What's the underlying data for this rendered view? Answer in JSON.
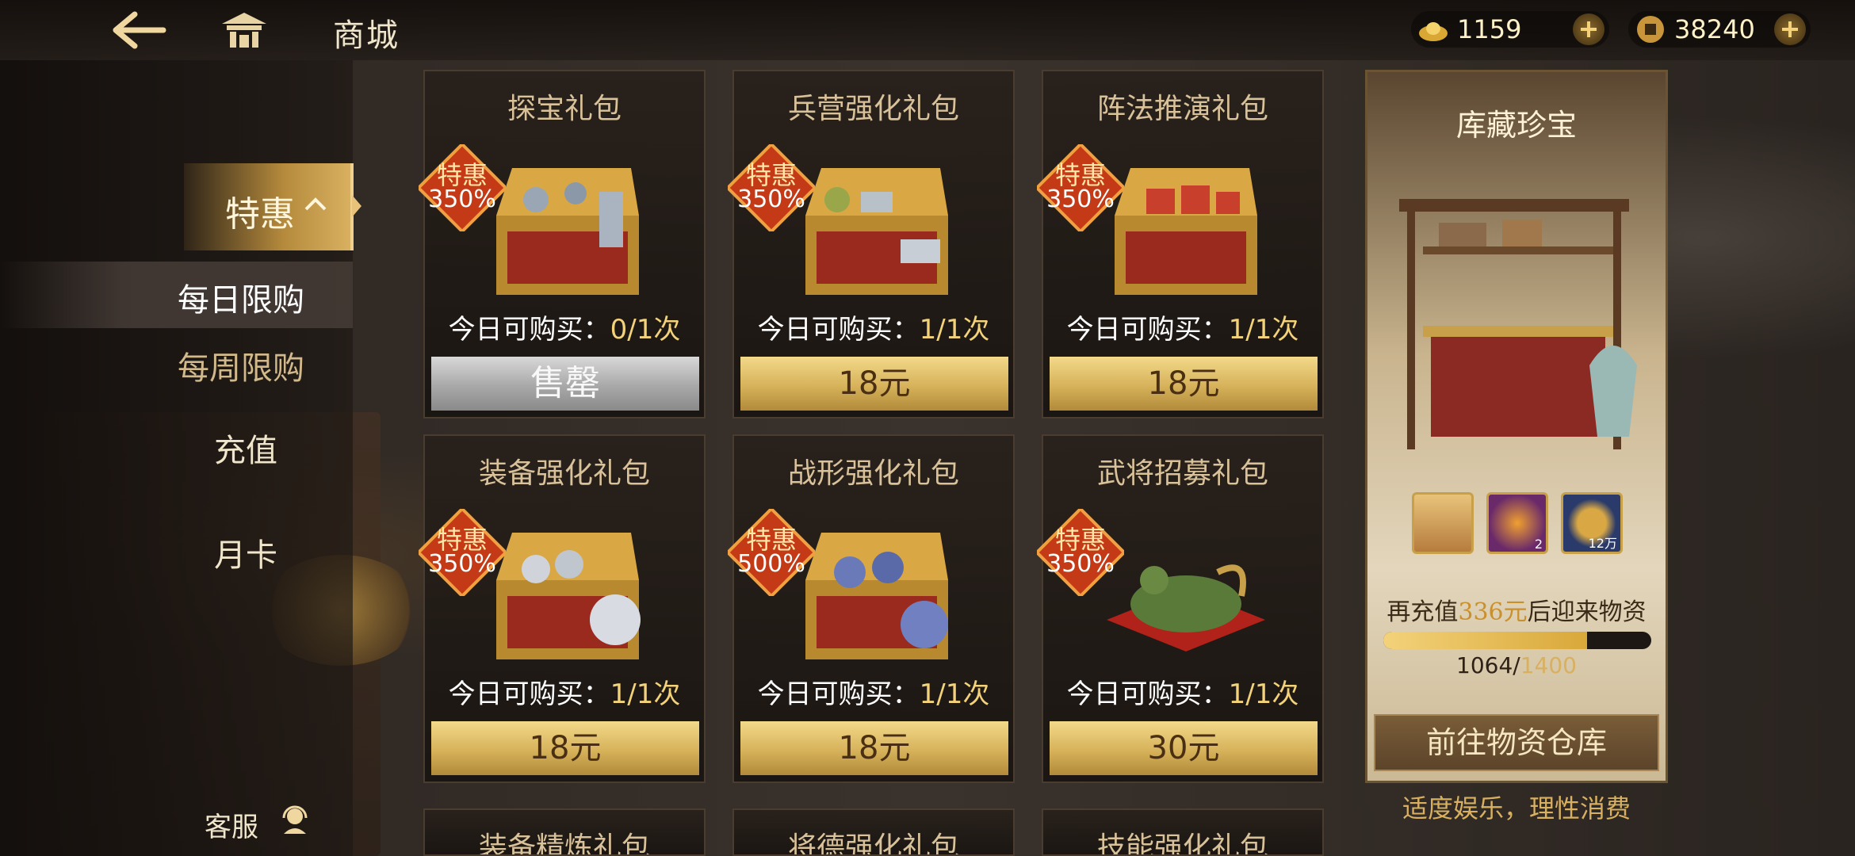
{
  "header": {
    "title": "商城"
  },
  "currency": {
    "gold": "1159",
    "coin": "38240"
  },
  "nav": {
    "main_tab": "特惠",
    "sub_tabs": [
      {
        "label": "每日限购"
      },
      {
        "label": "每周限购"
      }
    ],
    "items": [
      {
        "label": "充值"
      },
      {
        "label": "月卡"
      }
    ],
    "service": "客服"
  },
  "products": [
    {
      "name": "探宝礼包",
      "badge": "特惠",
      "percent": "350%",
      "limit_prefix": "今日可购买：",
      "limit": "0/1次",
      "price": "售罄"
    },
    {
      "name": "兵营强化礼包",
      "badge": "特惠",
      "percent": "350%",
      "limit_prefix": "今日可购买：",
      "limit": "1/1次",
      "price": "18元"
    },
    {
      "name": "阵法推演礼包",
      "badge": "特惠",
      "percent": "350%",
      "limit_prefix": "今日可购买：",
      "limit": "1/1次",
      "price": "18元"
    },
    {
      "name": "装备强化礼包",
      "badge": "特惠",
      "percent": "350%",
      "limit_prefix": "今日可购买：",
      "limit": "1/1次",
      "price": "18元"
    },
    {
      "name": "战形强化礼包",
      "badge": "特惠",
      "percent": "500%",
      "limit_prefix": "今日可购买：",
      "limit": "1/1次",
      "price": "18元"
    },
    {
      "name": "武将招募礼包",
      "badge": "特惠",
      "percent": "350%",
      "limit_prefix": "今日可购买：",
      "limit": "1/1次",
      "price": "30元"
    },
    {
      "name": "装备精炼礼包"
    },
    {
      "name": "将德强化礼包"
    },
    {
      "name": "技能强化礼包"
    }
  ],
  "treasure": {
    "title": "库藏珍宝",
    "items": [
      {
        "qty": ""
      },
      {
        "qty": "2"
      },
      {
        "qty": "12万"
      }
    ],
    "hint_prefix": "再充值",
    "hint_amount": "336元",
    "hint_suffix": "后迎来物资",
    "progress_current": "1064",
    "progress_sep": "/",
    "progress_total": "1400",
    "progress_ratio": 0.76,
    "button": "前往物资仓库"
  },
  "slogan": "适度娱乐，理性消费"
}
